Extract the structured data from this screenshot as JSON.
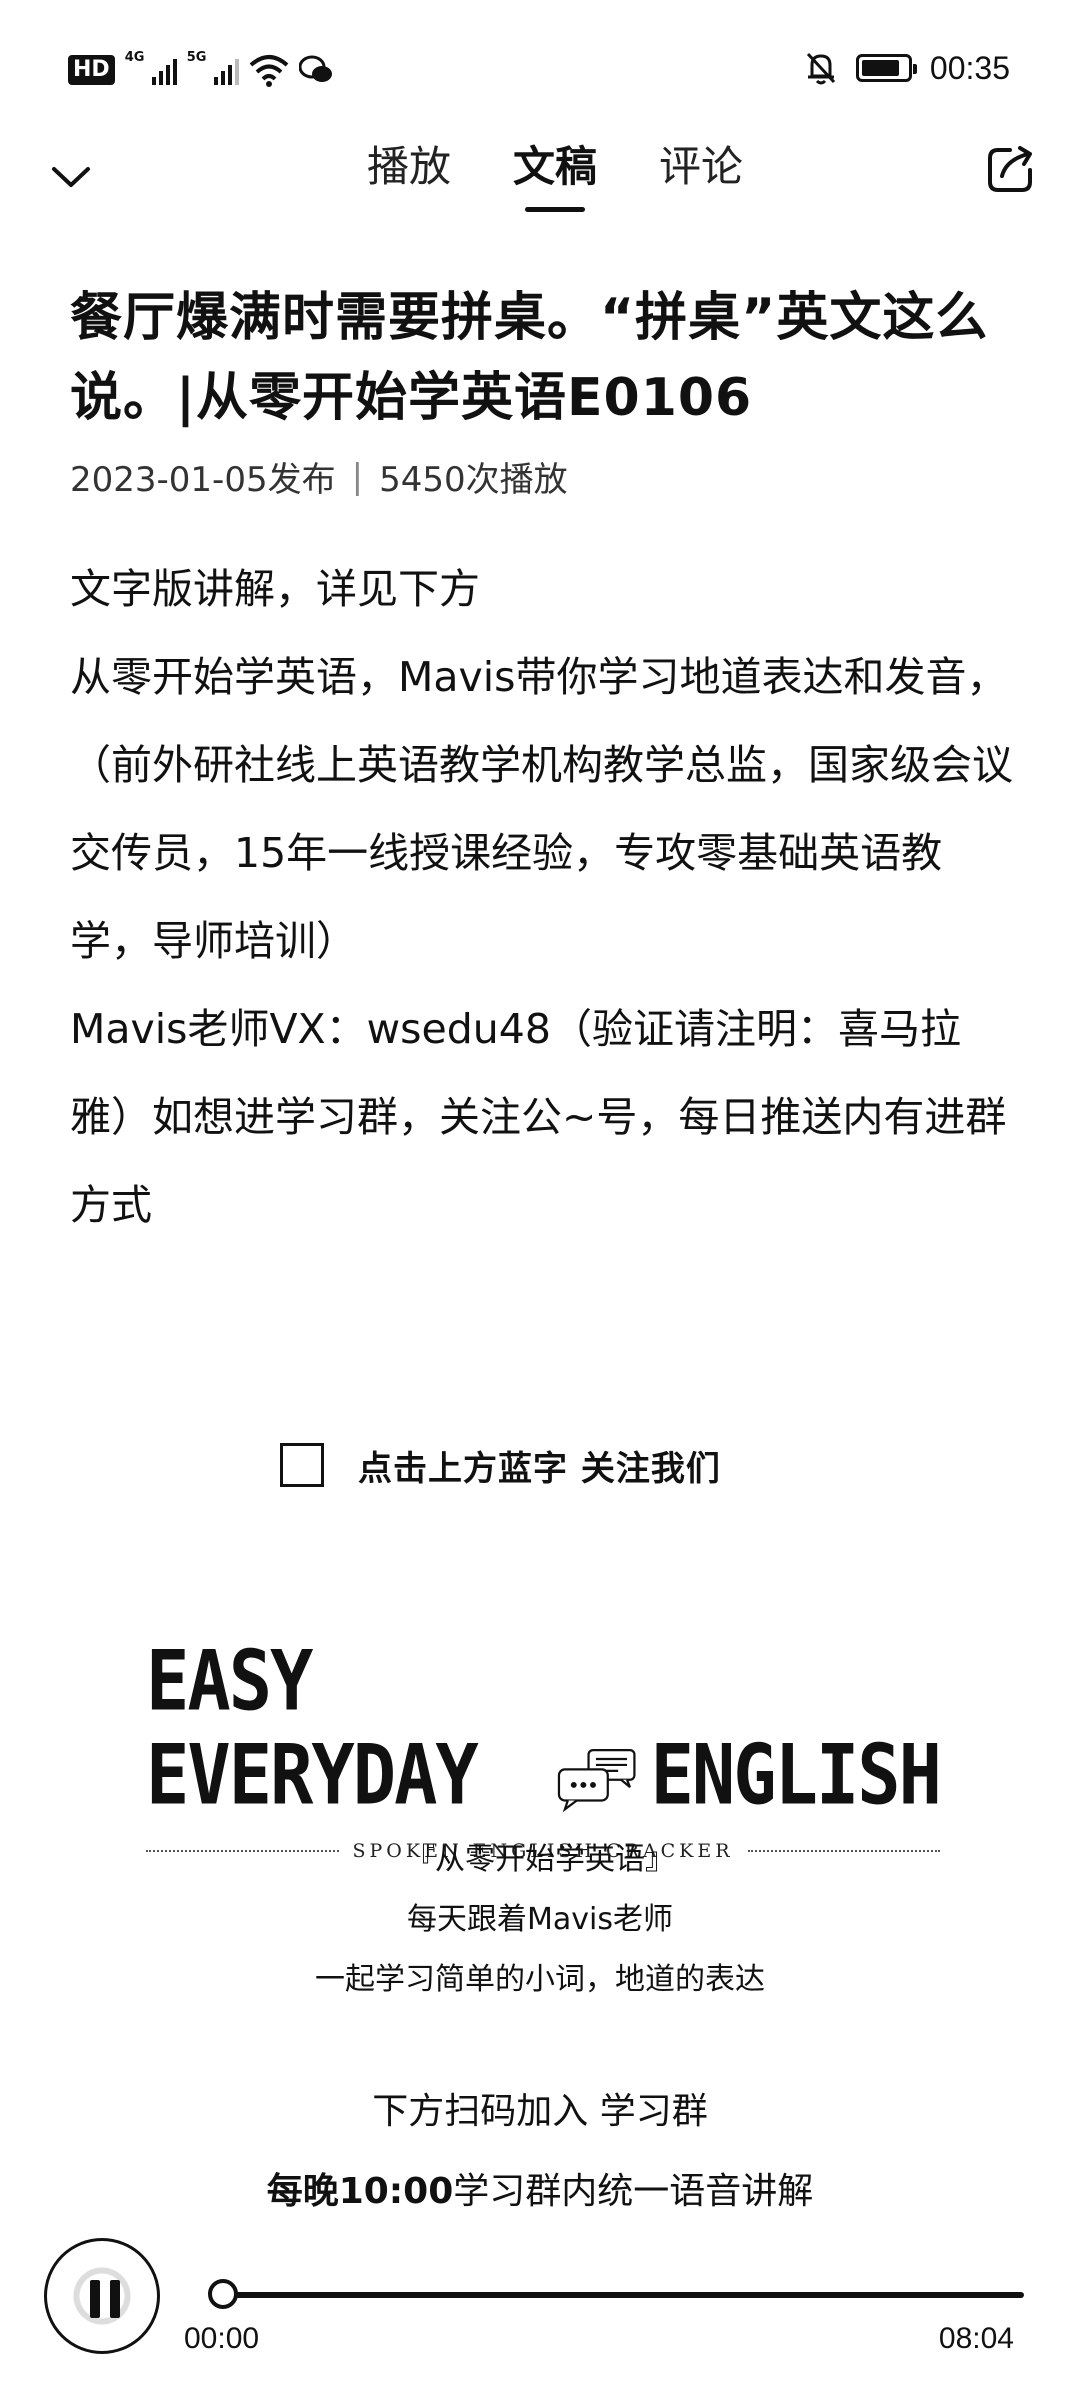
{
  "status_bar": {
    "hd_label": "HD",
    "net_1": "4G",
    "net_2": "5G",
    "time": "00:35",
    "battery_level": 0.85
  },
  "nav": {
    "tabs": [
      {
        "label": "播放",
        "active": false
      },
      {
        "label": "文稿",
        "active": true
      },
      {
        "label": "评论",
        "active": false
      }
    ]
  },
  "article": {
    "title": "餐厅爆满时需要拼桌。“拼桌”英文这么说。|从零开始学英语E0106",
    "date": "2023-01-05发布",
    "separator": "|",
    "plays": "5450次播放",
    "paragraphs": [
      "文字版讲解，详见下方",
      "从零开始学英语，Mavis带你学习地道表达和发音，（前外研社线上英语教学机构教学总监，国家级会议交传员，15年一线授课经验，专攻零基础英语教学，导师培训）",
      "Mavis老师VX：wsedu48（验证请注明：喜马拉雅）如想进学习群，关注公~号，每日推送内有进群方式"
    ],
    "follow_text": "点击上方蓝字 关注我们",
    "logo": {
      "left": "EASY EVERYDAY",
      "right": "ENGLISH",
      "subtitle": "SPOKEN ENGLISH CRACKER"
    },
    "promo_lines": [
      "『从零开始学英语』",
      "每天跟着Mavis老师",
      "一起学习简单的小词，地道的表达"
    ],
    "join_line": "下方扫码加入 学习群",
    "nightly_bold": "每晚10:00",
    "nightly_rest": "学习群内统一语音讲解"
  },
  "player": {
    "current_time": "00:00",
    "total_time": "08:04",
    "progress": 0
  }
}
